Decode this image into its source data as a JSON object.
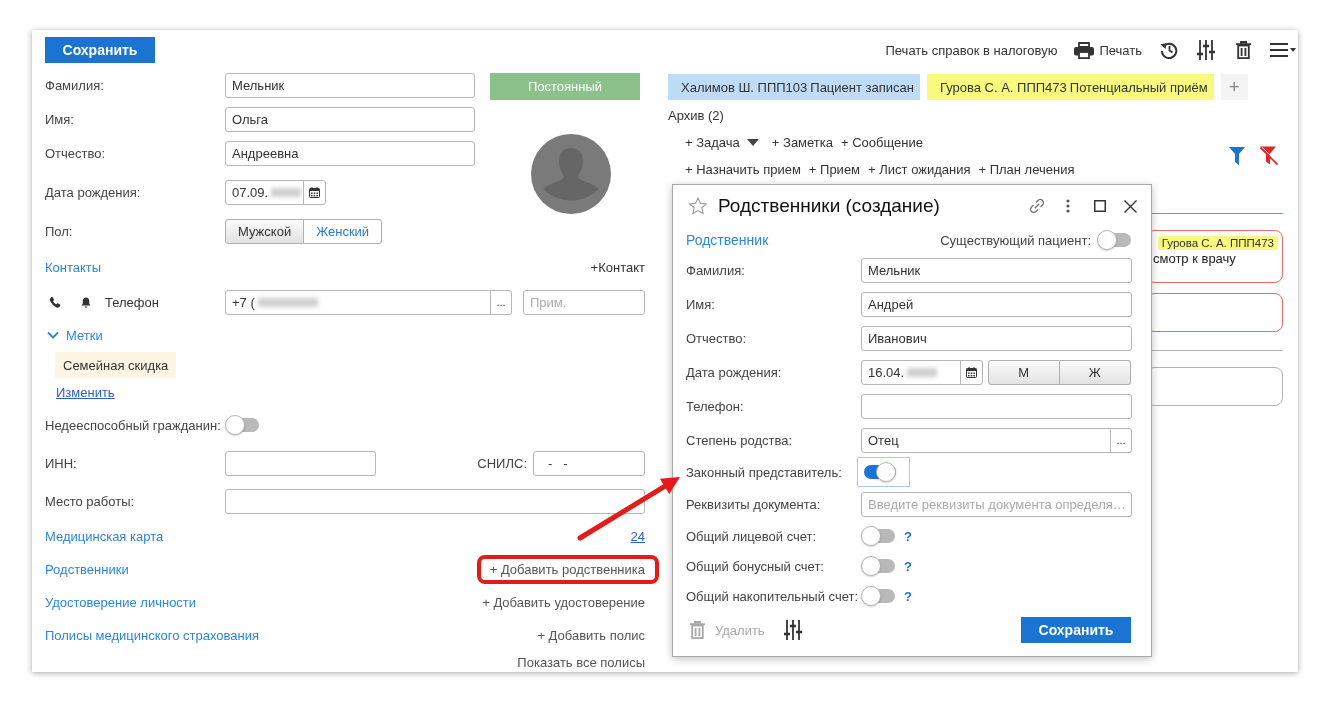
{
  "toolbar": {
    "save_button": "Сохранить",
    "tax_print_button": "Печать справок в налоговую",
    "print_button": "Печать"
  },
  "patient": {
    "status": "Постоянный",
    "name_fields": [
      {
        "label": "Фамилия:",
        "value": "Мельник"
      },
      {
        "label": "Имя:",
        "value": "Ольга"
      },
      {
        "label": "Отчество:",
        "value": "Андреевна"
      }
    ],
    "birth_date": {
      "label": "Дата рождения:",
      "value": "07.09.",
      "redacted": true
    },
    "sex": {
      "label": "Пол:",
      "options": [
        {
          "label": "Мужской",
          "selected": false
        },
        {
          "label": "Женский",
          "selected": true
        }
      ]
    },
    "contacts": {
      "title": "Контакты",
      "add_link": "+Контакт",
      "items": [
        {
          "kind": "phone",
          "type": "Телефон",
          "value": "+7 (",
          "redacted": true,
          "picker": "...",
          "note_placeholder": "Прим."
        }
      ]
    },
    "tags": {
      "title": "Метки",
      "expanded": true,
      "items": [
        "Семейная скидка"
      ],
      "edit_link": "Изменить"
    },
    "incapable": {
      "label": "Недееспособный гражданин:",
      "on": false
    },
    "inn": {
      "label": "ИНН:"
    },
    "snils": {
      "label": "СНИЛС:",
      "value": "-   -"
    },
    "workplace": {
      "label": "Место работы:"
    },
    "sections": [
      {
        "title": "Медицинская карта",
        "kind": "count",
        "action": "24",
        "highlighted": false
      },
      {
        "title": "Родственники",
        "kind": "add",
        "action": "+ Добавить родственника",
        "highlighted": true
      },
      {
        "title": "Удостоверение личности",
        "kind": "add",
        "action": "+ Добавить удостоверение",
        "highlighted": false
      },
      {
        "title": "Полисы медицинского страхования",
        "kind": "add",
        "action": "+ Добавить полис",
        "highlighted": false
      }
    ],
    "show_all_policies": "Показать все полисы"
  },
  "appointments": {
    "items": [
      {
        "name": "Халимов Ш. ППП103",
        "status": "Пациент записан",
        "color": "#bfdcf6"
      },
      {
        "name": "Гурова С. А. ППП473",
        "status": "Потенциальный приём",
        "color": "#f9f97f"
      }
    ],
    "add_button": "+"
  },
  "archive": "Архив (2)",
  "action_rows": [
    {
      "items": [
        {
          "kind": "dropdown",
          "label": "+ Задача"
        },
        {
          "kind": "plain",
          "label": "+ Заметка"
        },
        {
          "kind": "plain",
          "label": "+ Сообщение"
        }
      ]
    },
    {
      "items": [
        {
          "kind": "plain",
          "label": "+ Назначить прием"
        },
        {
          "kind": "plain",
          "label": "+ Прием"
        },
        {
          "kind": "plain",
          "label": "+ Лист ожидания"
        },
        {
          "kind": "plain",
          "label": "+ План лечения"
        }
      ]
    }
  ],
  "feed": [
    {
      "color": "#ef6b6b",
      "cards": [
        {
          "color": "#ef6b6b",
          "badge": "Гурова С. А. ППП473",
          "text": "смотр к врачу"
        },
        {
          "color": "#ef6b6b"
        }
      ]
    },
    {
      "color": "#b3b3b3",
      "cards": [
        {
          "color": "#b3b3b3"
        }
      ]
    }
  ],
  "dialog": {
    "title": "Родственники (создание)",
    "section": "Родственник",
    "existing_patient": {
      "label": "Существующий пациент:",
      "on": false
    },
    "fields": [
      {
        "kind": "text",
        "label": "Фамилия:",
        "value": "Мельник"
      },
      {
        "kind": "text",
        "label": "Имя:",
        "value": "Андрей"
      },
      {
        "kind": "text",
        "label": "Отчество:",
        "value": "Иванович"
      },
      {
        "kind": "date",
        "label": "Дата рождения:",
        "value": "16.04.",
        "redacted": true,
        "options": [
          {
            "label": "М",
            "selected": false
          },
          {
            "label": "Ж",
            "selected": false
          }
        ]
      },
      {
        "kind": "text",
        "label": "Телефон:"
      },
      {
        "kind": "choice",
        "label": "Степень родства:",
        "value": "Отец",
        "picker": "..."
      },
      {
        "kind": "toggle",
        "label": "Законный представитель:",
        "on": true,
        "focused": true
      },
      {
        "kind": "text",
        "label": "Реквизиты документа:",
        "placeholder": "Введите реквизиты документа определя…"
      },
      {
        "kind": "toggle",
        "label": "Общий лицевой счет:",
        "on": false,
        "focused": false,
        "help": "?"
      },
      {
        "kind": "toggle",
        "label": "Общий бонусный счет:",
        "on": false,
        "focused": false,
        "help": "?"
      },
      {
        "kind": "toggle",
        "label": "Общий накопительный счет:",
        "on": false,
        "focused": false,
        "help": "?"
      }
    ],
    "delete_button": {
      "label": "Удалить",
      "disabled": true
    },
    "save_button": "Сохранить"
  }
}
